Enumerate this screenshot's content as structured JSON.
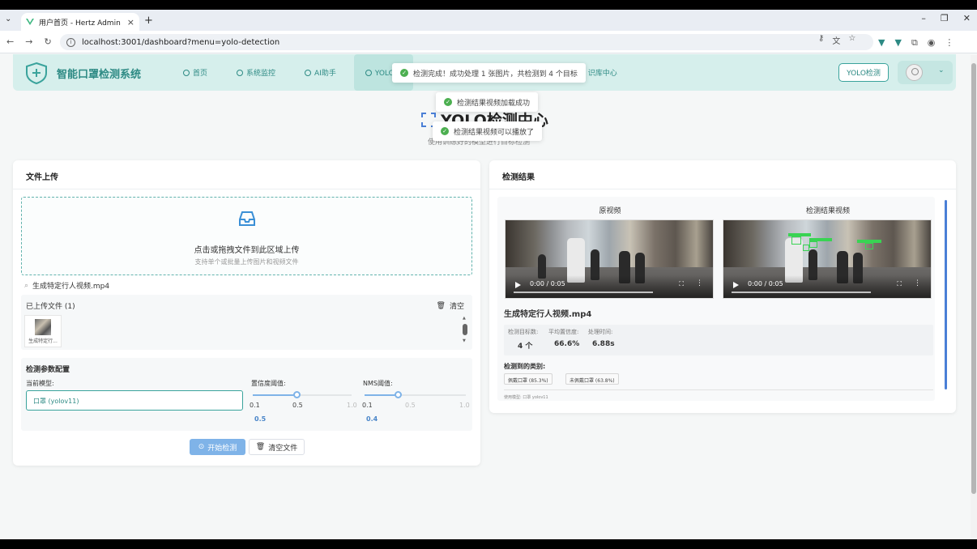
{
  "browser": {
    "tab_title": "用户首页 - Hertz Admin",
    "url": "localhost:3001/dashboard?menu=yolo-detection"
  },
  "header": {
    "brand": "智能口罩检测系统",
    "menu": [
      {
        "label": "首页"
      },
      {
        "label": "系统监控"
      },
      {
        "label": "AI助手"
      },
      {
        "label": "YOLO检"
      },
      {
        "label": "识库中心"
      }
    ],
    "yolo_button": "YOLO检测"
  },
  "page": {
    "title": "YOLO检测中心",
    "subtitle": "使用训练好的模型进行目标检测"
  },
  "toasts": [
    {
      "text": "检测完成！成功处理 1 张图片，共检测到 4 个目标"
    },
    {
      "text": "检测结果视频加载成功"
    },
    {
      "text": "检测结果视频可以播放了"
    }
  ],
  "upload": {
    "title": "文件上传",
    "dropzone_main": "点击或拖拽文件到此区域上传",
    "dropzone_hint": "支持单个或批量上传图片和视频文件",
    "selected_file": "生成特定行人视频.mp4",
    "uploaded_title": "已上传文件 (1)",
    "clear_label": "清空",
    "thumb_caption": "生成特定行...",
    "params_title": "检测参数配置",
    "model_label": "当前模型:",
    "model_value": "口罩 (yolov11)",
    "conf_label": "置信度阈值:",
    "nms_label": "NMS阈值:",
    "conf": {
      "min": "0.1",
      "mid": "0.5",
      "max": "1.0",
      "value": "0.5",
      "fraction": 0.44
    },
    "nms": {
      "min": "0.1",
      "mid": "0.5",
      "max": "1.0",
      "value": "0.4",
      "fraction": 0.33
    },
    "start_button": "开始检测",
    "clear_files_button": "清空文件"
  },
  "results": {
    "title": "检测结果",
    "original_label": "原视频",
    "result_label": "检测结果视频",
    "video_time": "0:00 / 0:05",
    "file_name": "生成特定行人视频.mp4",
    "stats": [
      {
        "key": "检测目标数:",
        "value": "4 个"
      },
      {
        "key": "平均置信度:",
        "value": "66.6%"
      },
      {
        "key": "处理时间:",
        "value": "6.88s"
      }
    ],
    "classes_title": "检测到的类别:",
    "classes": [
      "佩戴口罩 (85.3%)",
      "未佩戴口罩 (63.8%)"
    ],
    "footnote": "使用模型: 口罩 yolov11"
  }
}
